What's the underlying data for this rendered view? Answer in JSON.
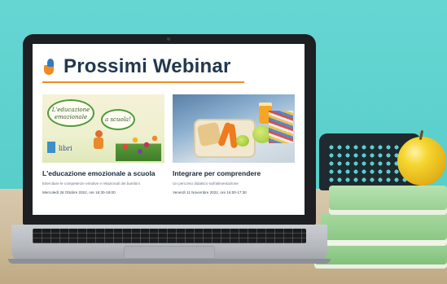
{
  "page": {
    "heading": "Prossimi Webinar"
  },
  "cards": [
    {
      "title": "L'educazione emozionale a scuola",
      "subtitle": "Esercitare le competenze emotive e relazionali dei bambini",
      "date": "Mercoledì 26 Ottobre 2022, ore 16:30-18:00",
      "thumbnail": {
        "bubble_left": "L'educazione emozionale",
        "bubble_right": "a scuola!",
        "brand": "libri"
      }
    },
    {
      "title": "Integrare per comprendere",
      "subtitle": "Un percorso didattico sull'alimentazione",
      "date": "Venerdì 11 Novembre 2022, ore 16:00-17:30"
    }
  ],
  "colors": {
    "accent": "#f08a24",
    "heading": "#22384f",
    "wall": "#5fd1cf"
  }
}
